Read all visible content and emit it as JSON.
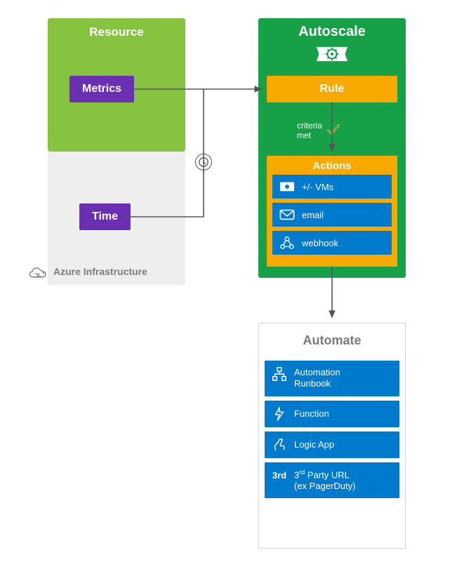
{
  "resource": {
    "title": "Resource",
    "metrics_label": "Metrics"
  },
  "time": {
    "label": "Time"
  },
  "azure_infra_label": "Azure Infrastructure",
  "autoscale": {
    "title": "Autoscale",
    "rule_label": "Rule",
    "criteria_line1": "criteria",
    "criteria_line2": "met",
    "actions_title": "Actions",
    "actions": [
      {
        "icon": "vm-icon",
        "label": "+/- VMs"
      },
      {
        "icon": "email-icon",
        "label": "email"
      },
      {
        "icon": "webhook-icon",
        "label": "webhook"
      }
    ]
  },
  "automate": {
    "title": "Automate",
    "items": [
      {
        "icon": "runbook-icon",
        "line1": "Automation",
        "line2": "Runbook"
      },
      {
        "icon": "function-icon",
        "line1": "Function"
      },
      {
        "icon": "logicapp-icon",
        "line1": "Logic App"
      },
      {
        "icon": "third-party",
        "line1": "3rd Party URL",
        "line2": "(ex PagerDuty)"
      }
    ]
  },
  "colors": {
    "green": "#16a047",
    "lime": "#86c440",
    "purple": "#6b2fb3",
    "orange": "#f8a900",
    "blue": "#007acc",
    "greyBox": "#eeeeee",
    "greyText": "#7a7a7a"
  }
}
